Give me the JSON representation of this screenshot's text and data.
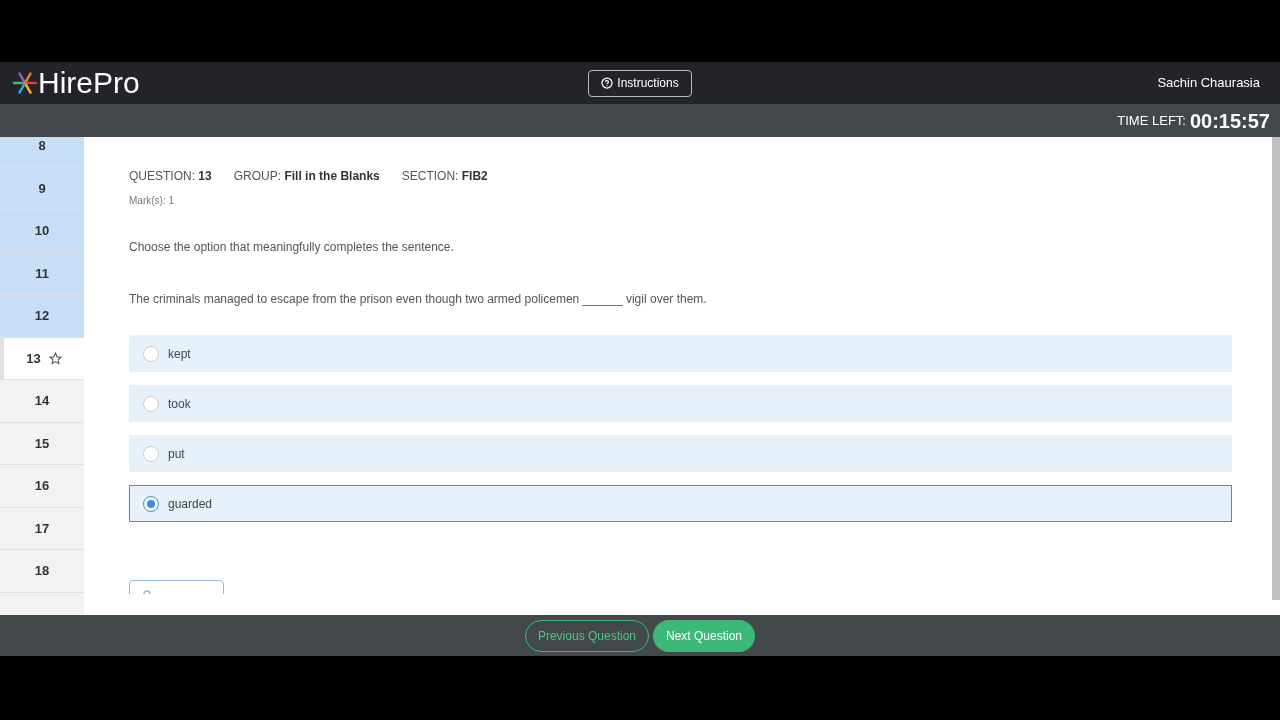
{
  "header": {
    "brand": "HirePro",
    "instructions_button": "Instructions",
    "user_name": "Sachin Chaurasia"
  },
  "timer": {
    "label": "TIME LEFT:",
    "value": "00:15:57"
  },
  "question_nav": [
    {
      "number": "8",
      "kind": "answered",
      "selected": false
    },
    {
      "number": "9",
      "kind": "answered",
      "selected": false
    },
    {
      "number": "10",
      "kind": "answered",
      "selected": false
    },
    {
      "number": "11",
      "kind": "answered",
      "selected": false
    },
    {
      "number": "12",
      "kind": "answered",
      "selected": false
    },
    {
      "number": "13",
      "kind": "current",
      "selected": true
    },
    {
      "number": "14",
      "kind": "unvisited",
      "selected": false
    },
    {
      "number": "15",
      "kind": "unvisited",
      "selected": false
    },
    {
      "number": "16",
      "kind": "unvisited",
      "selected": false
    },
    {
      "number": "17",
      "kind": "unvisited",
      "selected": false
    },
    {
      "number": "18",
      "kind": "unvisited",
      "selected": false
    }
  ],
  "question": {
    "question_label": "QUESTION:",
    "question_number": "13",
    "group_label": "GROUP:",
    "group": "Fill in the Blanks",
    "section_label": "SECTION:",
    "section": "FIB2",
    "marks_label": "Mark(s):",
    "marks": "1",
    "instruction": "Choose the option that meaningfully completes the sentence.",
    "sentence": "The criminals managed to escape from the prison even though two armed policemen ______ vigil over them.",
    "options": [
      {
        "label": "kept",
        "selected": false
      },
      {
        "label": "took",
        "selected": false
      },
      {
        "label": "put",
        "selected": false
      },
      {
        "label": "guarded",
        "selected": true
      }
    ]
  },
  "footer": {
    "previous": "Previous Question",
    "next": "Next Question"
  }
}
